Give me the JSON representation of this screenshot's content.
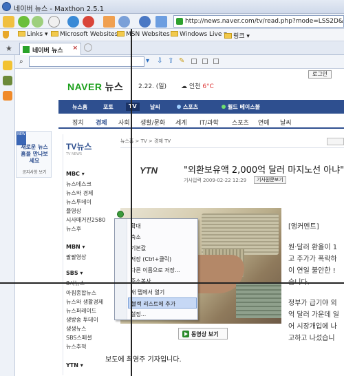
{
  "window": {
    "title": "네이버 뉴스 - Maxthon 2.5.1"
  },
  "address": {
    "url": "http://news.naver.com/tv/read.php?mode=LSS2D&office_id="
  },
  "bookmarks": [
    "Links",
    "Microsoft Websites",
    "MSN Websites",
    "Windows Live",
    "링크"
  ],
  "tab": {
    "label": "네이버 뉴스",
    "close": "×"
  },
  "header": {
    "logo": "NAVER",
    "logo_kr": "뉴스",
    "date": "2.22. (일)",
    "weather_city": "인천",
    "weather_temp": "6°C",
    "login": "로그인"
  },
  "bluenav": [
    {
      "label": "뉴스홈"
    },
    {
      "label": "포토"
    },
    {
      "label": "TV"
    },
    {
      "label": "날씨"
    },
    {
      "label": "스포츠"
    },
    {
      "label": "월드 베이스볼"
    }
  ],
  "subnav": [
    "정치",
    "경제",
    "사회",
    "생활/문화",
    "세계",
    "IT/과학",
    "스포츠",
    "연예",
    "날씨"
  ],
  "promo": {
    "ribbon": "NEW",
    "text": "새로운 뉴스홈을 만나보세요",
    "link": "공지사항 보기"
  },
  "left": {
    "logo": "TV뉴스",
    "logo_sub": "TV NEWS",
    "mbc": "MBC",
    "mbc_items": [
      "뉴스데스크",
      "뉴스와 경제",
      "뉴스투데이",
      "플영상",
      "시사매거진2580",
      "뉴스후"
    ],
    "mbn": "MBN",
    "mbn_items": [
      "팔팔영상"
    ],
    "sbs": "SBS",
    "sbs_items": [
      "8시뉴스",
      "아침종합뉴스",
      "뉴스와 생활경제",
      "뉴스퍼레이드",
      "생방송 투데이",
      "생생뉴스",
      "SBS스페셜",
      "뉴스추적"
    ],
    "ytn": "YTN"
  },
  "article": {
    "breadcrumb": "뉴스홈 > TV > 경제 TV",
    "source": "YTN",
    "headline": "\"외환보유액 2,000억 달러 마지노선 아냐\"",
    "meta": "기사입력 2009-02-22 12:29",
    "meta_button": "기사원문보기",
    "video_button": "동영상 보기",
    "caption": "보도에 최영주 기자입니다.",
    "body": [
      "[앵커멘트]",
      "원·달러 환율이 1",
      "고 주가가 폭락하",
      "이 연일 불안한 !",
      "습니다.",
      "정부가 급기야 외",
      "억 달러 가운데 일",
      "어 시장개입에 나",
      "고하고 나섰습니"
    ]
  },
  "context_menu": {
    "items": [
      "확대",
      "축소",
      "기본값",
      "저장 (Ctrl+클릭)",
      "다른 이름으로 저장...",
      "주소복사",
      "새 탭에서 열기",
      "블랙 리스트에 추가",
      "설정..."
    ],
    "highlighted": "블랙 리스트에 추가"
  }
}
